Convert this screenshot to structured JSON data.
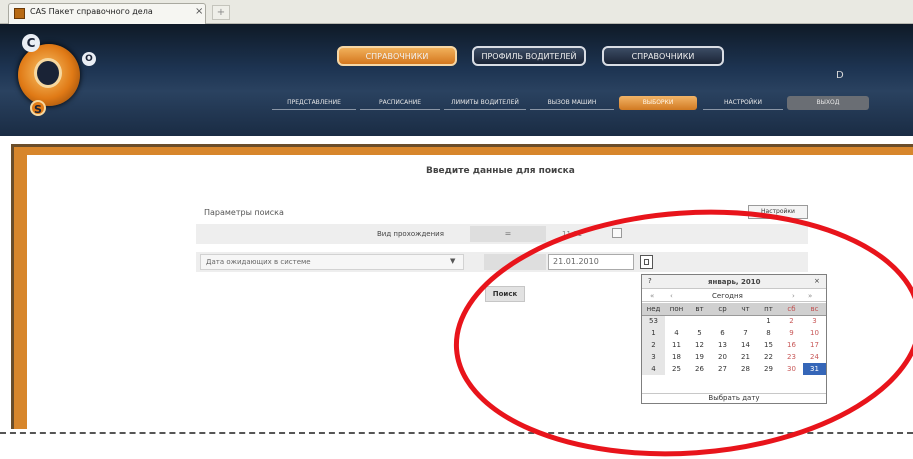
{
  "browser": {
    "tab_title": "CAS Пакет справочного дела",
    "tab_close": "×",
    "new_tab": "+"
  },
  "header": {
    "logo_letters": [
      "C",
      "O",
      "S"
    ],
    "top_nav": [
      "СПРАВОЧНИКИ",
      "ПРОФИЛЬ ВОДИТЕЛЕЙ",
      "СПРАВОЧНИКИ"
    ],
    "sub_nav": [
      "ПРЕДСТАВЛЕНИЕ",
      "РАСПИСАНИЕ",
      "ЛИМИТЫ ВОДИТЕЛЕЙ",
      "ВЫЗОВ МАШИН",
      "ВЫБОРКИ",
      "НАСТРОЙКИ",
      "ВЫХОД"
    ],
    "edge_label": "D"
  },
  "form": {
    "title": "Введите данные для поиска",
    "params_label": "Параметры поиска",
    "params_button": "Настройки",
    "row1": {
      "label": "Вид прохождения",
      "comparator": "=",
      "value": "11.01"
    },
    "row2": {
      "select_text": "Дата ожидающих в системе",
      "select_arrow": "▼",
      "comparator": "—",
      "date_value": "21.01.2010"
    },
    "submit": "Поиск"
  },
  "calendar": {
    "help": "?",
    "month_title": "январь, 2010",
    "close": "×",
    "prev_year": "«",
    "prev_month": "‹",
    "today_label": "Сегодня",
    "next_month": "›",
    "next_year": "»",
    "headers": [
      "нед",
      "пон",
      "вт",
      "ср",
      "чт",
      "пт",
      "сб",
      "вс"
    ],
    "weeks": [
      [
        "53",
        "",
        "",
        "",
        "",
        "1",
        "2",
        "3"
      ],
      [
        "1",
        "4",
        "5",
        "6",
        "7",
        "8",
        "9",
        "10"
      ],
      [
        "2",
        "11",
        "12",
        "13",
        "14",
        "15",
        "16",
        "17"
      ],
      [
        "3",
        "18",
        "19",
        "20",
        "21",
        "22",
        "23",
        "24"
      ],
      [
        "4",
        "25",
        "26",
        "27",
        "28",
        "29",
        "30",
        "31"
      ]
    ],
    "selected_day": "31",
    "footer": "Выбрать дату"
  },
  "colors": {
    "header_dark": "#1d3452",
    "accent_orange": "#d7862c",
    "frame_brown": "#6a4d2a",
    "selected_day": "#3566b8",
    "annotation_red": "#e8141b"
  }
}
